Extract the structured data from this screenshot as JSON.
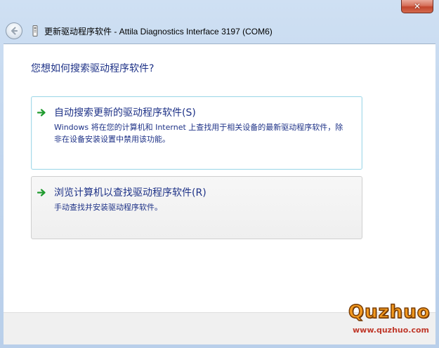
{
  "window": {
    "title": "更新驱动程序软件 - Attila Diagnostics Interface 3197 (COM6)",
    "close_label": "✕"
  },
  "content": {
    "heading": "您想如何搜索驱动程序软件?",
    "options": [
      {
        "title": "自动搜索更新的驱动程序软件(S)",
        "description": "Windows 将在您的计算机和 Internet 上查找用于相关设备的最新驱动程序软件，除非在设备安装设置中禁用该功能。"
      },
      {
        "title": "浏览计算机以查找驱动程序软件(R)",
        "description": "手动查找并安装驱动程序软件。"
      }
    ]
  },
  "watermark": {
    "logo": "Quzhuo",
    "url": "www.quzhuo.com"
  },
  "colors": {
    "link_text": "#1e3287",
    "arrow_green": "#1f9b2e",
    "selected_border": "#a7dbea"
  },
  "icons": {
    "back": "back-arrow-icon",
    "device": "device-icon",
    "option_arrow": "green-arrow-icon"
  }
}
